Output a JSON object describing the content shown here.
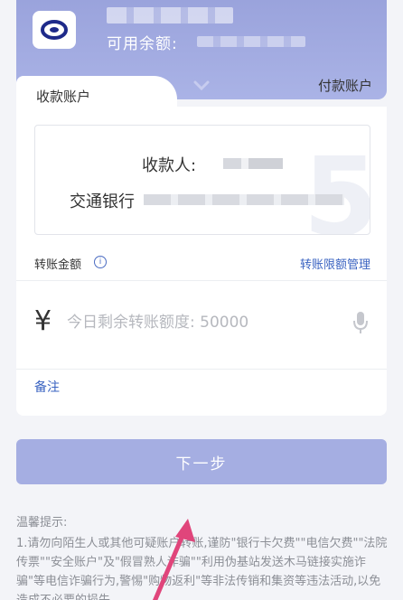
{
  "payer_card": {
    "balance_label": "可用余额:",
    "payer_tab_label": "付款账户"
  },
  "payee": {
    "tab_label": "收款账户",
    "name_label": "收款人:",
    "bank_name": "交通银行"
  },
  "amount": {
    "label": "转账金额",
    "limit_link": "转账限额管理",
    "currency_symbol": "¥",
    "placeholder": "今日剩余转账额度: 50000"
  },
  "remark_label": "备注",
  "next_button_label": "下一步",
  "tips": {
    "title": "温馨提示:",
    "body": "1.请勿向陌生人或其他可疑账户转账,谨防\"银行卡欠费\"\"电信欠费\"\"法院传票\"\"安全账户\"及\"假冒熟人诈骗\"\"利用伪基站发送木马链接实施诈骗\"等电信诈骗行为,警惕\"购物返利\"等非法传销和集资等违法活动,以免造成不必要的损失。"
  },
  "colors": {
    "accent": "#3a63c1",
    "card": "#9aa3dc",
    "button": "#a5aee2",
    "arrow": "#e0457b"
  },
  "icons": {
    "bank_logo": "bank-logo-icon",
    "chevron": "chevron-down-icon",
    "info": "info-icon",
    "mic": "microphone-icon"
  }
}
